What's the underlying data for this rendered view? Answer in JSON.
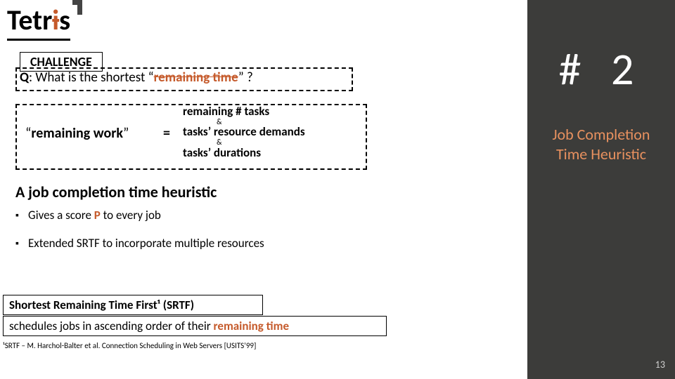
{
  "title_plain": "Tetr",
  "title_strike": "i",
  "title_tail": "s",
  "challenge_label": "CHALLENGE",
  "q_prefix": "Q",
  "q_text_a": ": What is the shortest “",
  "q_rt": "remaining time",
  "q_text_b": "” ?",
  "rw_open": "“",
  "rw_text": "remaining work",
  "rw_close": "”",
  "eq": "=",
  "rw_line1": "remaining # tasks",
  "rw_amp": "&",
  "rw_line2": "tasks’ resource demands",
  "rw_line3": "tasks’ durations",
  "h2": "A job completion time heuristic",
  "b1_a": "Gives a score ",
  "b1_P": "P",
  "b1_b": " to every job",
  "b2": "Extended SRTF to incorporate multiple resources",
  "srtf1": "Shortest Remaining Time First¹ (SRTF)",
  "srtf2_a": "schedules jobs in ascending order of their ",
  "srtf2_rt": "remaining time",
  "foot": "¹SRTF – M. Harchol-Balter et al. Connection Scheduling in Web Servers [USITS’99]",
  "bignum": "# 2",
  "sub1": "Job Completion",
  "sub2": "Time Heuristic",
  "page": "13"
}
